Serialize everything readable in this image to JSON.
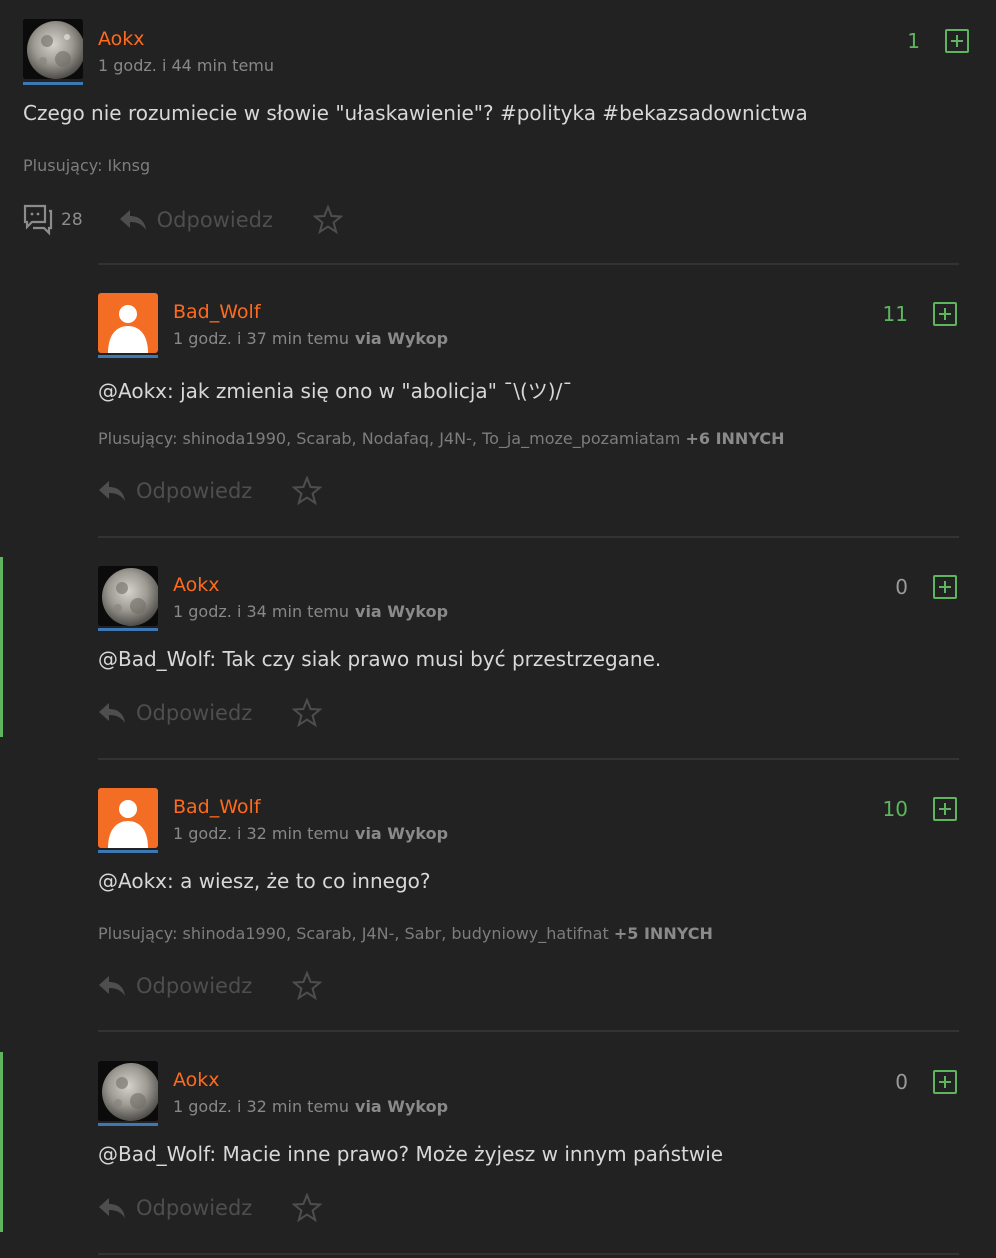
{
  "colors": {
    "background": "#222223",
    "username": "#ff6a1c",
    "vote_positive": "#5eb55e",
    "avatar_underline": "#3c78b4",
    "default_avatar": "#f46d24"
  },
  "main_post": {
    "author": "Aokx",
    "time": "1 godz. i 44 min temu",
    "votes": "1",
    "text": "Czego nie rozumiecie w słowie \"ułaskawienie\"? #polityka #bekazsadownictwa",
    "voters": "Plusujący: Iknsg",
    "comments_count": "28",
    "reply_label": "Odpowiedz",
    "icons": [
      "comment-icon",
      "reply-icon",
      "star-icon",
      "plus-icon"
    ]
  },
  "comments": [
    {
      "author": "Bad_Wolf",
      "time": "1 godz. i 37 min temu",
      "via": "via Wykop",
      "votes": "11",
      "text": "@Aokx: jak zmienia się ono w \"abolicja\" ¯\\(ツ)/¯",
      "voters": "Plusujący: shinoda1990, Scarab, Nodafaq, J4N-, To_ja_moze_pozamiatam",
      "voters_more": "+6 INNYCH",
      "reply_label": "Odpowiedz"
    },
    {
      "author": "Aokx",
      "time": "1 godz. i 34 min temu",
      "via": "via Wykop",
      "votes": "0",
      "text": "@Bad_Wolf: Tak czy siak prawo musi być przestrzegane.",
      "reply_label": "Odpowiedz"
    },
    {
      "author": "Bad_Wolf",
      "time": "1 godz. i 32 min temu",
      "via": "via Wykop",
      "votes": "10",
      "text": "@Aokx: a wiesz, że to co innego?",
      "voters": "Plusujący: shinoda1990, Scarab, J4N-, Sabr, budyniowy_hatifnat",
      "voters_more": "+5 INNYCH",
      "reply_label": "Odpowiedz"
    },
    {
      "author": "Aokx",
      "time": "1 godz. i 32 min temu",
      "via": "via Wykop",
      "votes": "0",
      "text": "@Bad_Wolf: Macie inne prawo? Może żyjesz w innym państwie",
      "reply_label": "Odpowiedz"
    }
  ]
}
